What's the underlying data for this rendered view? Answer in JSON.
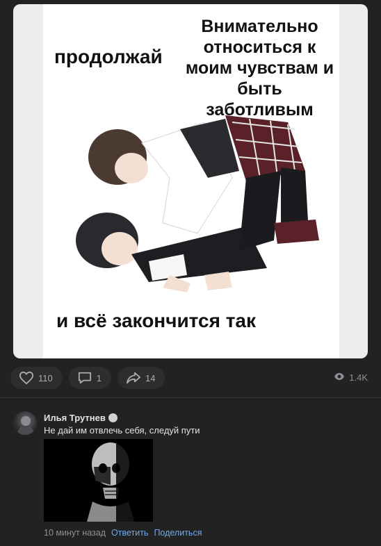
{
  "post": {
    "meme": {
      "top_left_text": "продолжай",
      "top_right_text": "Внимательно относиться к моим чувствам и быть заботливым",
      "bottom_text": "и всё закончится так"
    },
    "actions": {
      "likes": "110",
      "comments": "1",
      "shares": "14",
      "views": "1.4K"
    }
  },
  "comment": {
    "author": "Илья Трутнев",
    "text": "Не дай им отвлечь себя, следуй пути",
    "time": "10 минут назад",
    "reply_label": "Ответить",
    "share_label": "Поделиться"
  },
  "icons": {
    "like": "heart-icon",
    "comment": "comment-icon",
    "share": "share-arrow-icon",
    "views": "eye-icon"
  },
  "colors": {
    "background": "#222222",
    "pill": "#2d2d2d",
    "link": "#71aaeb",
    "muted": "#8d9097"
  }
}
